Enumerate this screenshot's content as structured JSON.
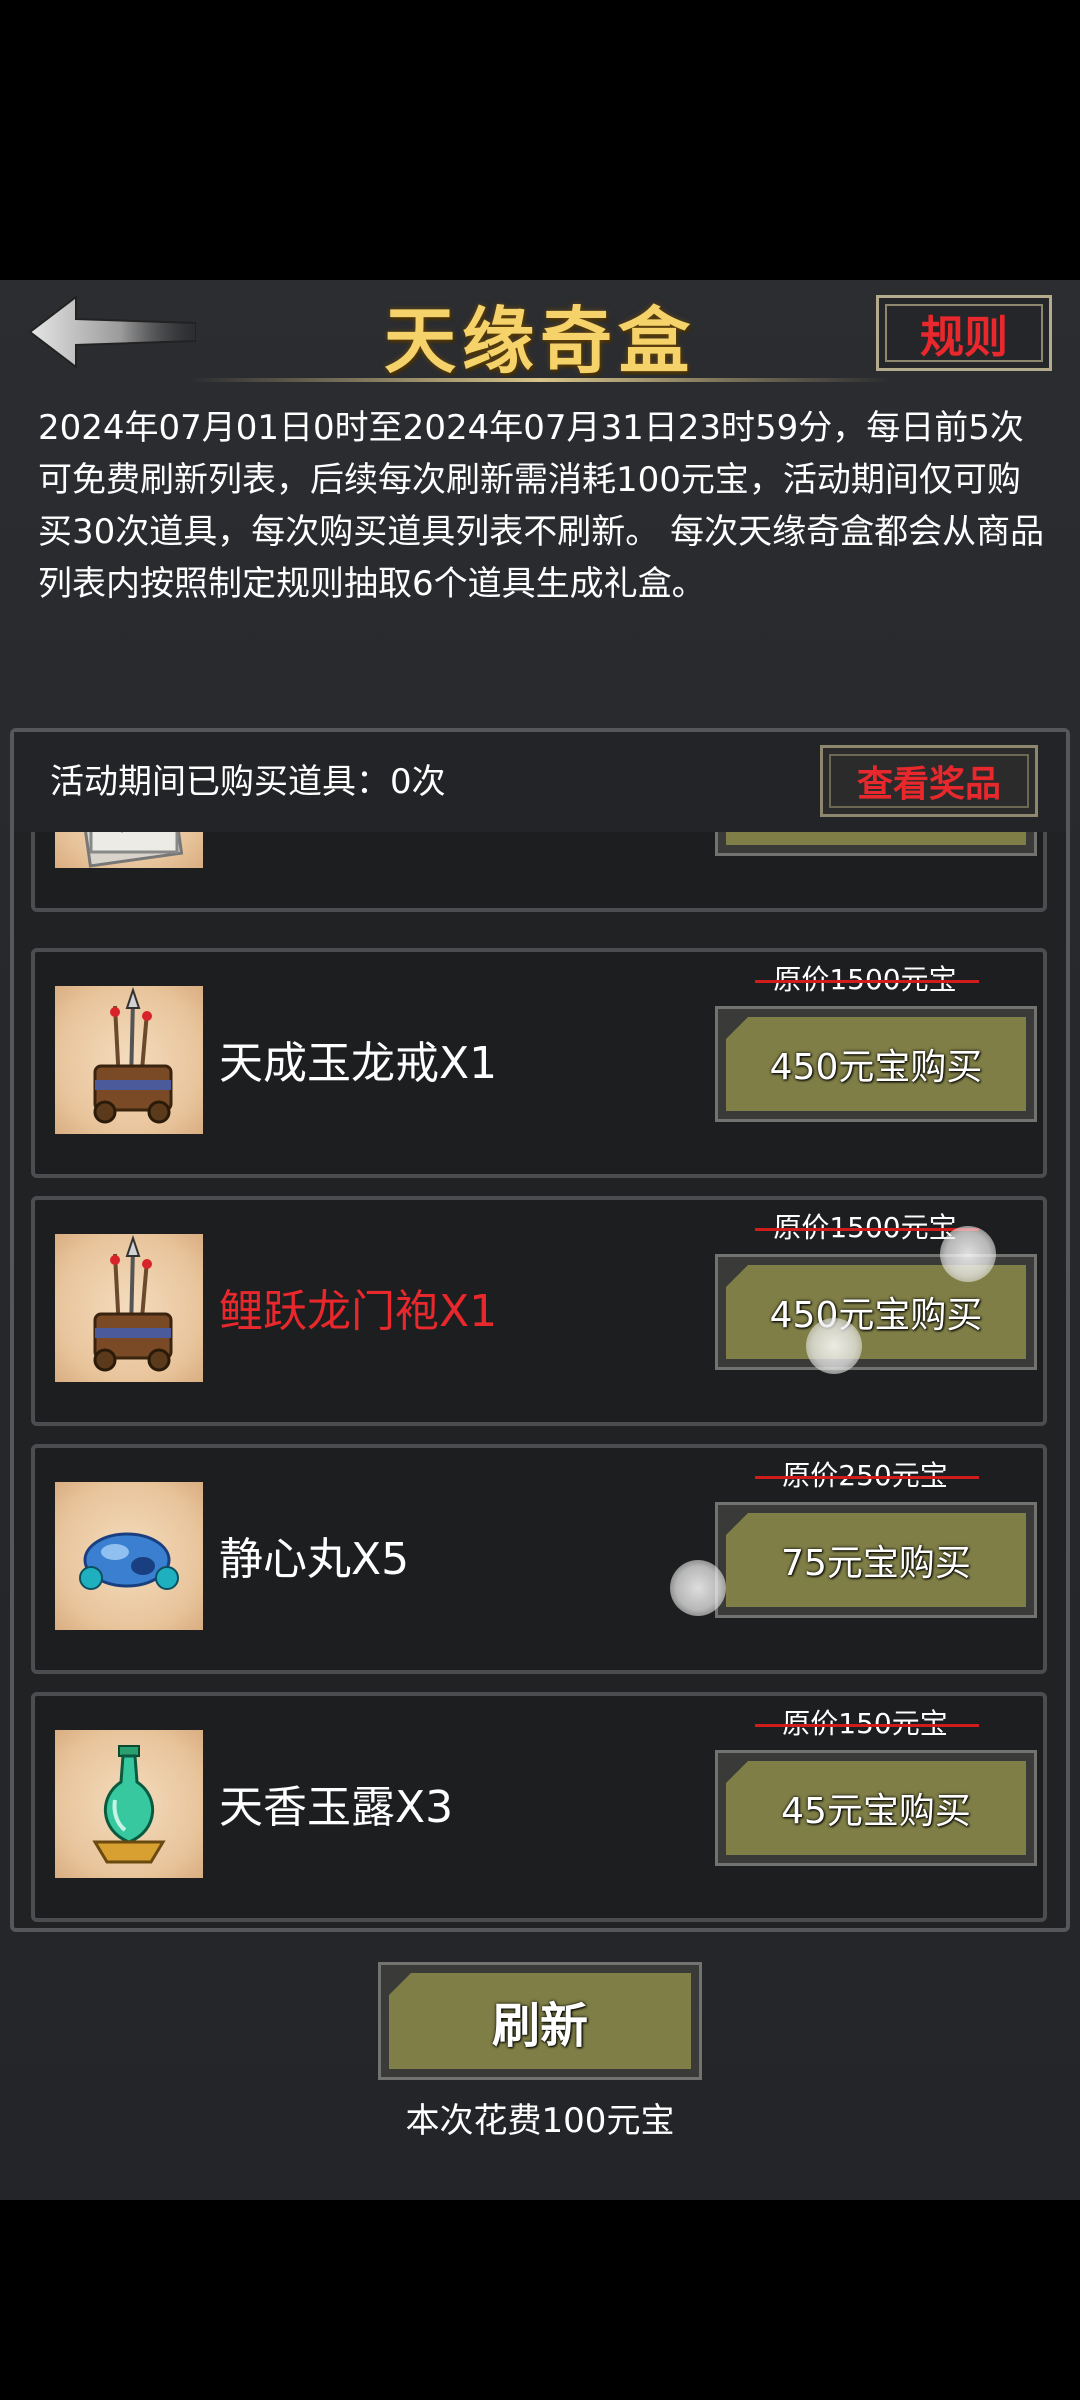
{
  "header": {
    "title": "天缘奇盒",
    "back_icon": "back-arrow-icon",
    "rules_label": "规则"
  },
  "description": "2024年07月01日0时至2024年07月31日23时59分，每日前5次可免费刷新列表，后续每次刷新需消耗100元宝，活动期间仅可购买30次道具，每次购买道具列表不刷新。 每次天缘奇盒都会从商品列表内按照制定规则抽取6个道具生成礼盒。",
  "status": {
    "purchased_label": "活动期间已购买道具：0次",
    "view_prizes_label": "查看奖品"
  },
  "items": [
    {
      "name": "",
      "original_price": "",
      "buy_label": "",
      "icon": "scroll-icon",
      "highlight": false
    },
    {
      "name": "天成玉龙戒X1",
      "original_price": "原价1500元宝",
      "buy_label": "450元宝购买",
      "icon": "weapon-rack-icon",
      "highlight": false
    },
    {
      "name": "鲤跃龙门袍X1",
      "original_price": "原价1500元宝",
      "buy_label": "450元宝购买",
      "icon": "weapon-rack-icon",
      "highlight": true
    },
    {
      "name": "静心丸X5",
      "original_price": "原价250元宝",
      "buy_label": "75元宝购买",
      "icon": "blue-pill-icon",
      "highlight": false
    },
    {
      "name": "天香玉露X3",
      "original_price": "原价150元宝",
      "buy_label": "45元宝购买",
      "icon": "jade-vase-icon",
      "highlight": false
    }
  ],
  "footer": {
    "refresh_label": "刷新",
    "refresh_cost": "本次花费100元宝"
  },
  "colors": {
    "title_gold": "#f5d36a",
    "accent_red": "#e8282c",
    "button_olive": "#7f7e46",
    "panel_bg": "#26282c"
  }
}
